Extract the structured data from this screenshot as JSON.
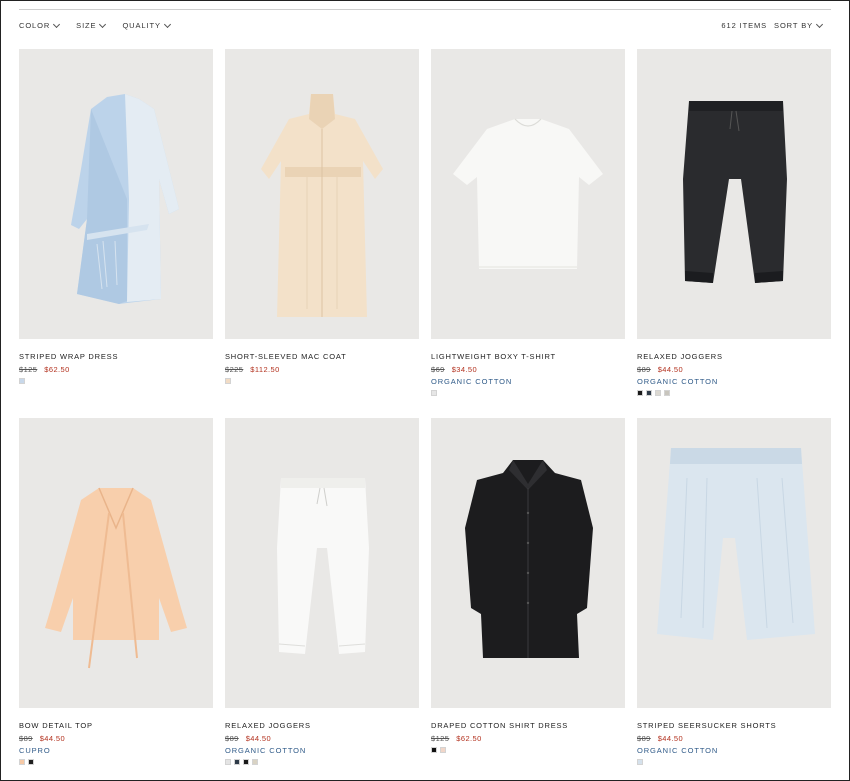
{
  "filters": [
    {
      "label": "COLOR"
    },
    {
      "label": "SIZE"
    },
    {
      "label": "QUALITY"
    }
  ],
  "toolbar": {
    "items_count": "612 ITEMS",
    "sort_label": "SORT BY"
  },
  "products": [
    {
      "name": "STRIPED WRAP DRESS",
      "old_price": "$125",
      "sale_price": "$62.50",
      "quality": "",
      "swatches": [
        "#c8d8ea"
      ]
    },
    {
      "name": "SHORT-SLEEVED MAC COAT",
      "old_price": "$225",
      "sale_price": "$112.50",
      "quality": "",
      "swatches": [
        "#f2dcc5"
      ]
    },
    {
      "name": "LIGHTWEIGHT BOXY T-SHIRT",
      "old_price": "$69",
      "sale_price": "$34.50",
      "quality": "ORGANIC COTTON",
      "swatches": [
        "#e6e6e6"
      ]
    },
    {
      "name": "RELAXED JOGGERS",
      "old_price": "$89",
      "sale_price": "$44.50",
      "quality": "ORGANIC COTTON",
      "swatches": [
        "#1a1a1a",
        "#2e3a48",
        "#dcd9d2",
        "#c8c5bd"
      ]
    },
    {
      "name": "BOW DETAIL TOP",
      "old_price": "$89",
      "sale_price": "$44.50",
      "quality": "CUPRO",
      "swatches": [
        "#f6c9a6",
        "#1f1f1f"
      ]
    },
    {
      "name": "RELAXED JOGGERS",
      "old_price": "$89",
      "sale_price": "$44.50",
      "quality": "ORGANIC COTTON",
      "swatches": [
        "#e4e4e4",
        "#2e3a48",
        "#1a1a1a",
        "#d9d3c4"
      ]
    },
    {
      "name": "DRAPED COTTON SHIRT DRESS",
      "old_price": "$125",
      "sale_price": "$62.50",
      "quality": "",
      "swatches": [
        "#111111",
        "#f1d6c8"
      ]
    },
    {
      "name": "STRIPED SEERSUCKER SHORTS",
      "old_price": "$89",
      "sale_price": "$44.50",
      "quality": "ORGANIC COTTON",
      "swatches": [
        "#d5e1ec"
      ]
    }
  ]
}
